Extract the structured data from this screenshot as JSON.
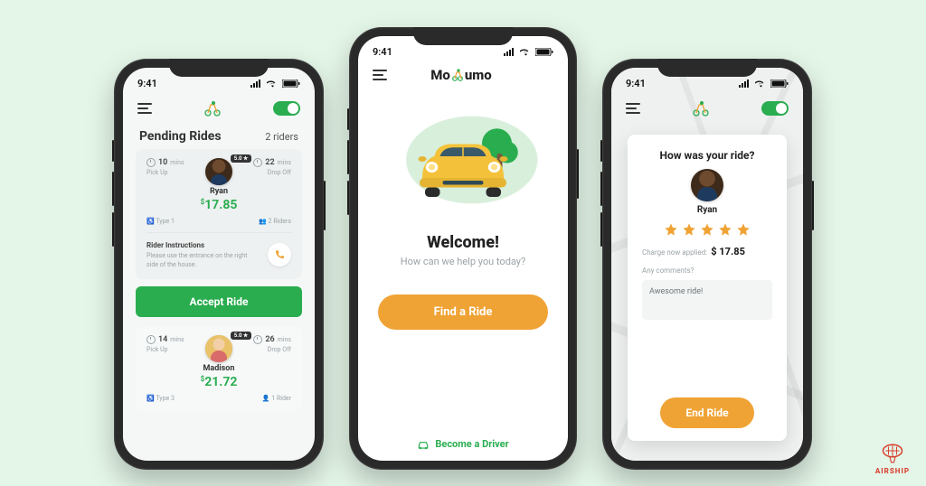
{
  "status": {
    "time": "9:41"
  },
  "colors": {
    "green": "#2aad4f",
    "orange": "#f0a335"
  },
  "phone1": {
    "title": "Pending Rides",
    "rider_count": "2 riders",
    "accept_label": "Accept Ride",
    "rides": [
      {
        "rating_badge": "5.0 ★",
        "pickup_value": "10",
        "pickup_unit": "mins",
        "pickup_label": "Pick Up",
        "dropoff_value": "22",
        "dropoff_unit": "mins",
        "dropoff_label": "Drop Off",
        "name": "Ryan",
        "price_symbol": "$",
        "price": "17.85",
        "type": "Type 1",
        "riders": "2 Riders",
        "instructions_title": "Rider Instructions",
        "instructions_text": "Please use the entrance on the right side of the house."
      },
      {
        "rating_badge": "5.0 ★",
        "pickup_value": "14",
        "pickup_unit": "mins",
        "pickup_label": "Pick Up",
        "dropoff_value": "26",
        "dropoff_unit": "mins",
        "dropoff_label": "Drop Off",
        "name": "Madison",
        "price_symbol": "$",
        "price": "21.72",
        "type": "Type 3",
        "riders": "1 Rider"
      }
    ]
  },
  "phone2": {
    "brand_pre": "Mo",
    "brand_post": "umo",
    "welcome_title": "Welcome!",
    "welcome_sub": "How can we help you today?",
    "find_label": "Find a Ride",
    "driver_link": "Become a Driver"
  },
  "phone3": {
    "title": "How was your ride?",
    "rider_name": "Ryan",
    "stars": 5,
    "charge_label": "Charge now applied:",
    "charge_amount": "$ 17.85",
    "comment_label": "Any comments?",
    "comment_value": "Awesome ride!",
    "end_label": "End Ride"
  },
  "watermark": "AIRSHIP"
}
